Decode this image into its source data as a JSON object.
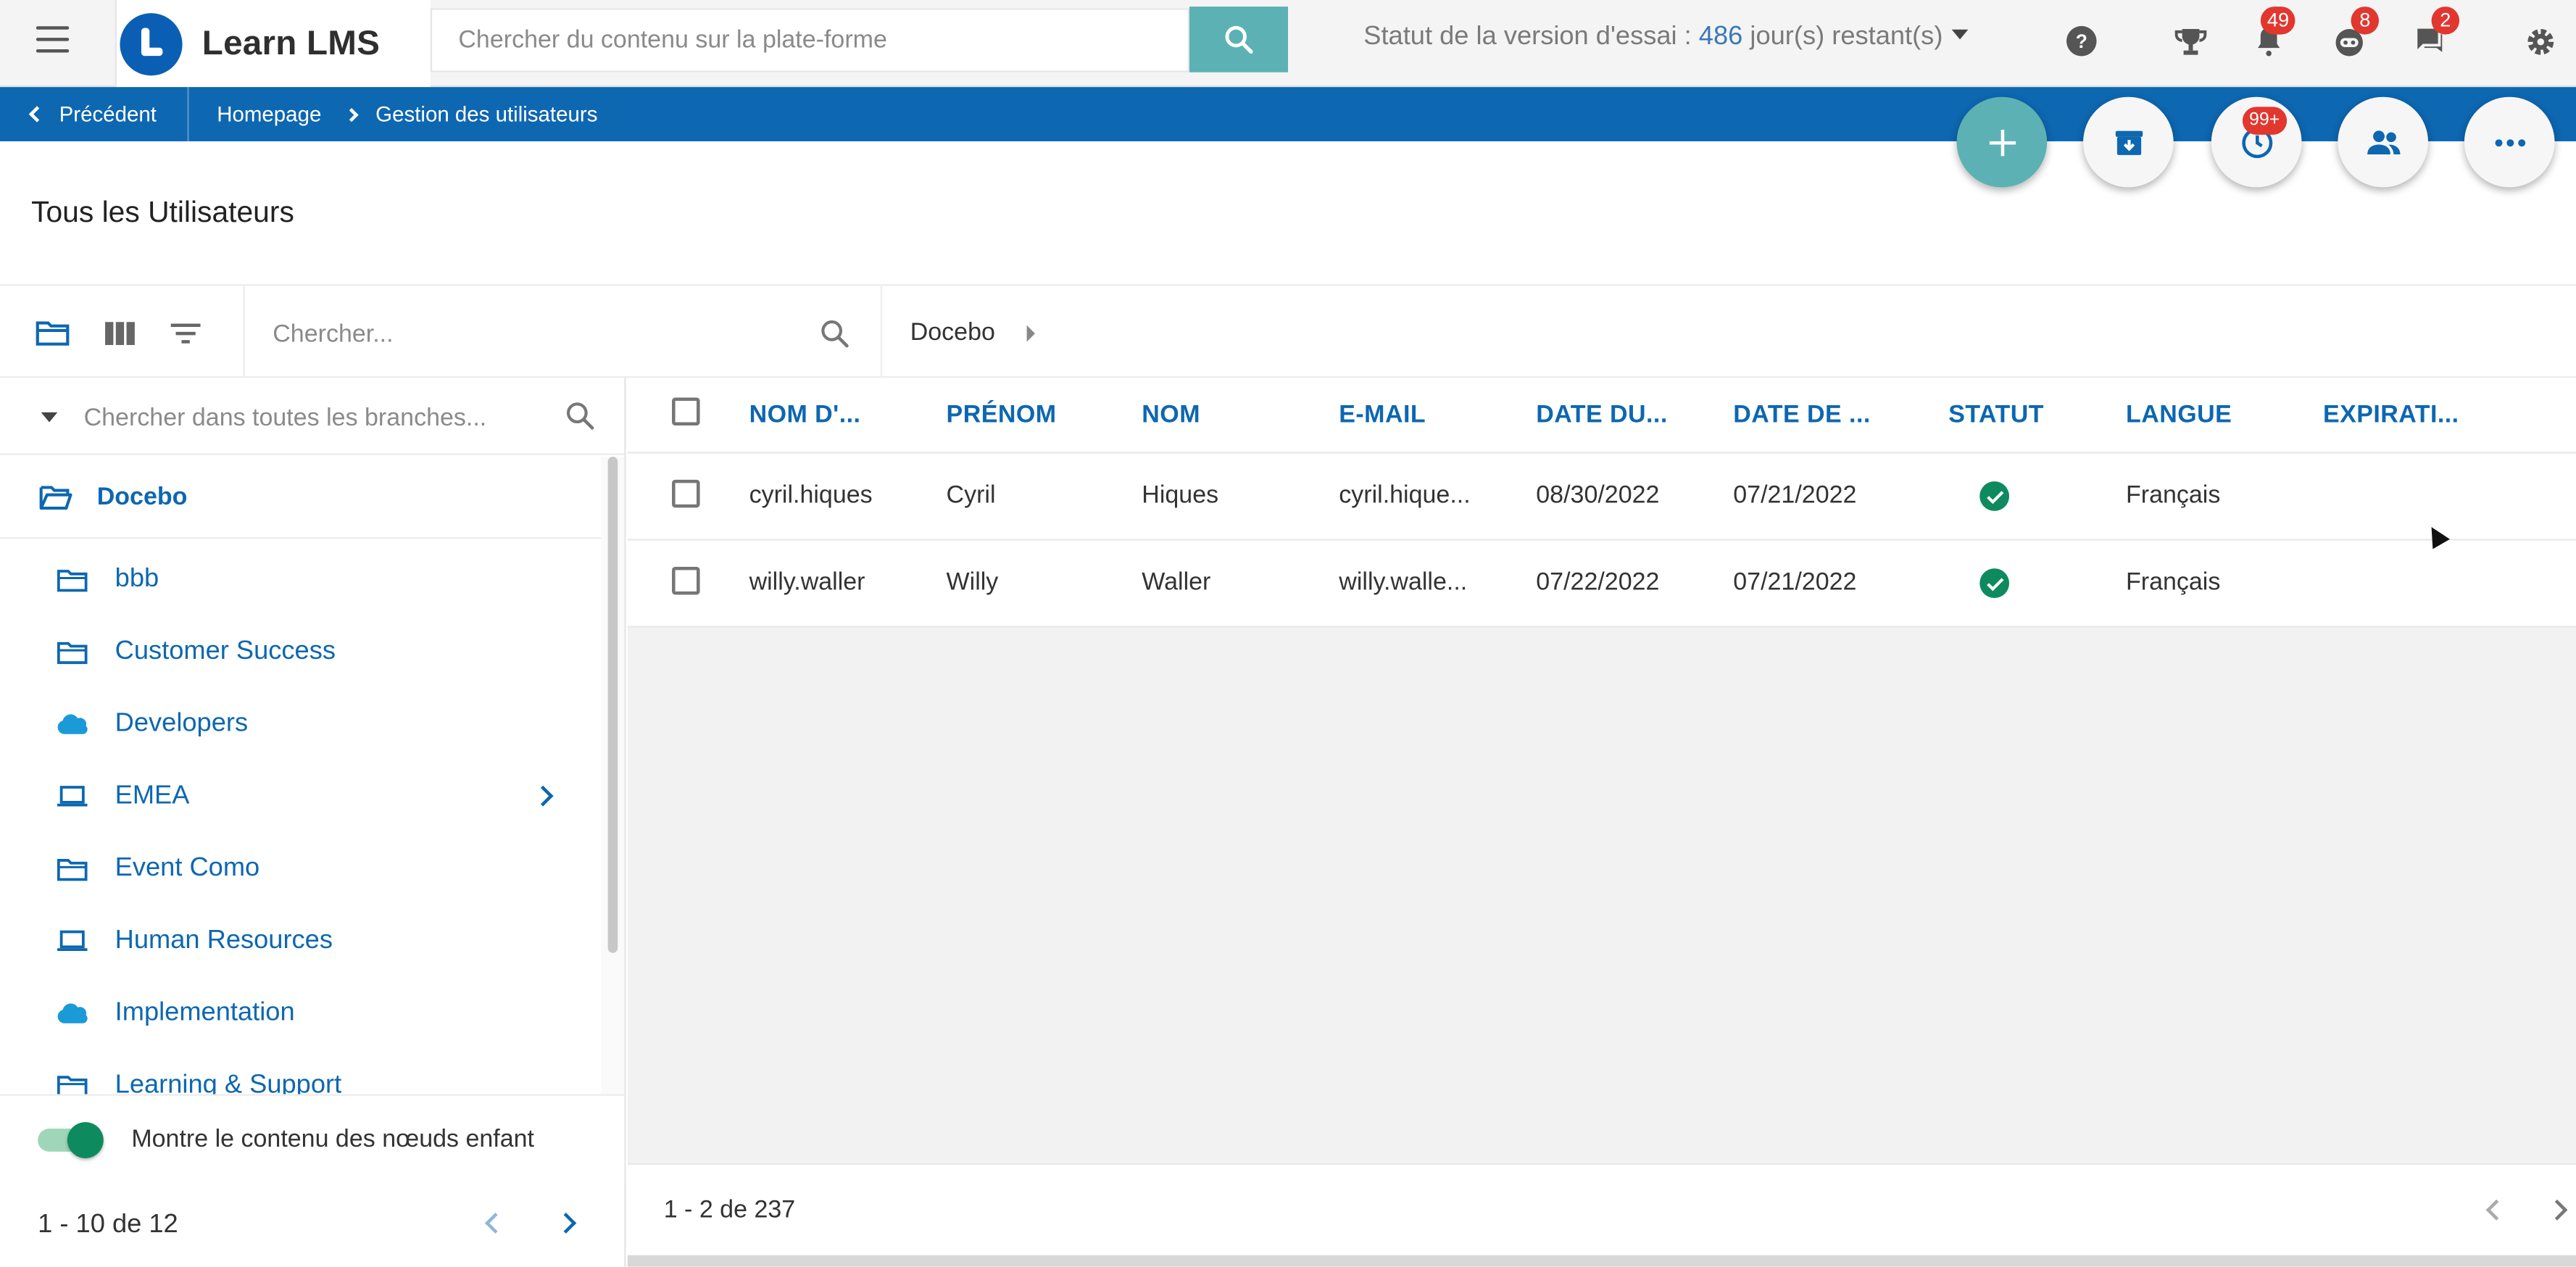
{
  "header": {
    "logo_text": "Learn LMS",
    "search_placeholder": "Chercher du contenu sur la plate-forme",
    "trial_prefix": "Statut de la version d'essai : ",
    "trial_days": "486",
    "trial_suffix": " jour(s) restant(s)",
    "notifications_badge": "49",
    "bot_badge": "8",
    "messages_badge": "2"
  },
  "breadcrumb": {
    "back_label": "Précédent",
    "items": [
      "Homepage",
      "Gestion des utilisateurs"
    ]
  },
  "fabs": {
    "history_badge": "99+"
  },
  "page": {
    "title": "Tous les Utilisateurs"
  },
  "toolbar": {
    "search_placeholder": "Chercher...",
    "current_branch": "Docebo"
  },
  "tree": {
    "search_placeholder": "Chercher dans toutes les branches...",
    "root": "Docebo",
    "items": [
      {
        "label": "bbb",
        "icon": "folder-icon"
      },
      {
        "label": "Customer Success",
        "icon": "folder-icon"
      },
      {
        "label": "Developers",
        "icon": "salesforce-cloud-icon"
      },
      {
        "label": "EMEA",
        "icon": "laptop-icon"
      },
      {
        "label": "Event Como",
        "icon": "folder-icon"
      },
      {
        "label": "Human Resources",
        "icon": "laptop-icon"
      },
      {
        "label": "Implementation",
        "icon": "salesforce-cloud-icon"
      },
      {
        "label": "Learning & Support",
        "icon": "folder-icon"
      }
    ],
    "toggle_label": "Montre le contenu des nœuds enfant",
    "pager_text": "1 - 10 de 12"
  },
  "table": {
    "columns": [
      "NOM D'...",
      "PRÉNOM",
      "NOM",
      "E-MAIL",
      "DATE DU...",
      "DATE DE ...",
      "STATUT",
      "LANGUE",
      "EXPIRATI..."
    ],
    "rows": [
      {
        "username": "cyril.hiques",
        "first": "Cyril",
        "last": "Hiques",
        "email": "cyril.hique...",
        "date1": "08/30/2022",
        "date2": "07/21/2022",
        "status": "active",
        "language": "Français",
        "expiration": ""
      },
      {
        "username": "willy.waller",
        "first": "Willy",
        "last": "Waller",
        "email": "willy.walle...",
        "date1": "07/22/2022",
        "date2": "07/21/2022",
        "status": "active",
        "language": "Français",
        "expiration": ""
      }
    ],
    "pager_text": "1 - 2 de 237"
  },
  "colors": {
    "brand_blue": "#0d67b1",
    "teal": "#5cb1b4",
    "badge_red": "#e1372f",
    "status_green": "#0e8a5f"
  }
}
